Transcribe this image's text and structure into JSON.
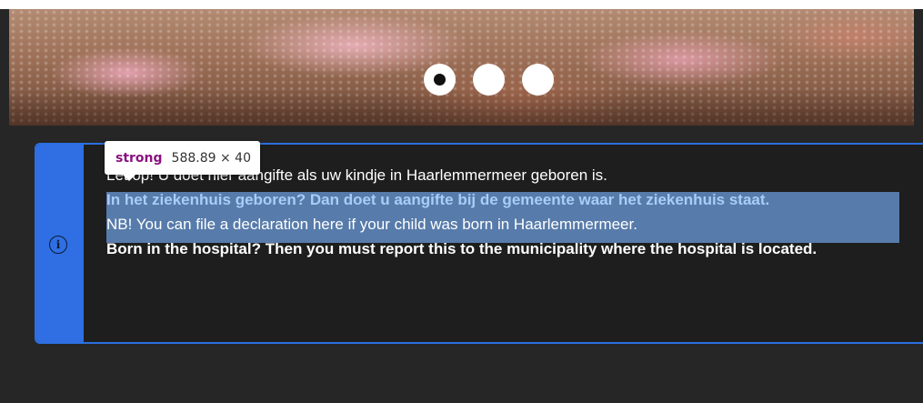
{
  "carousel": {
    "slides": [
      {
        "label": "slide-1",
        "active": true
      },
      {
        "label": "slide-2",
        "active": false
      },
      {
        "label": "slide-3",
        "active": false
      }
    ]
  },
  "devtools_tooltip": {
    "tag": "strong",
    "dimensions": "588.89 × 40"
  },
  "notice": {
    "icon": "info-icon",
    "accent_color": "#2f6fe3",
    "highlight_color": "#6ea0e1",
    "line_nl_intro": "Let op! U doet hier aangifte als uw kindje in Haarlemmermeer geboren is.",
    "line_nl_strong": "In het ziekenhuis geboren? Dan doet u aangifte bij de gemeente waar het ziekenhuis staat.",
    "line_en_intro": "NB! You can file a declaration here if your child was born in Haarlemmermeer.",
    "line_en_strong": "Born in the hospital? Then you must report this to the municipality where the hospital is located."
  }
}
